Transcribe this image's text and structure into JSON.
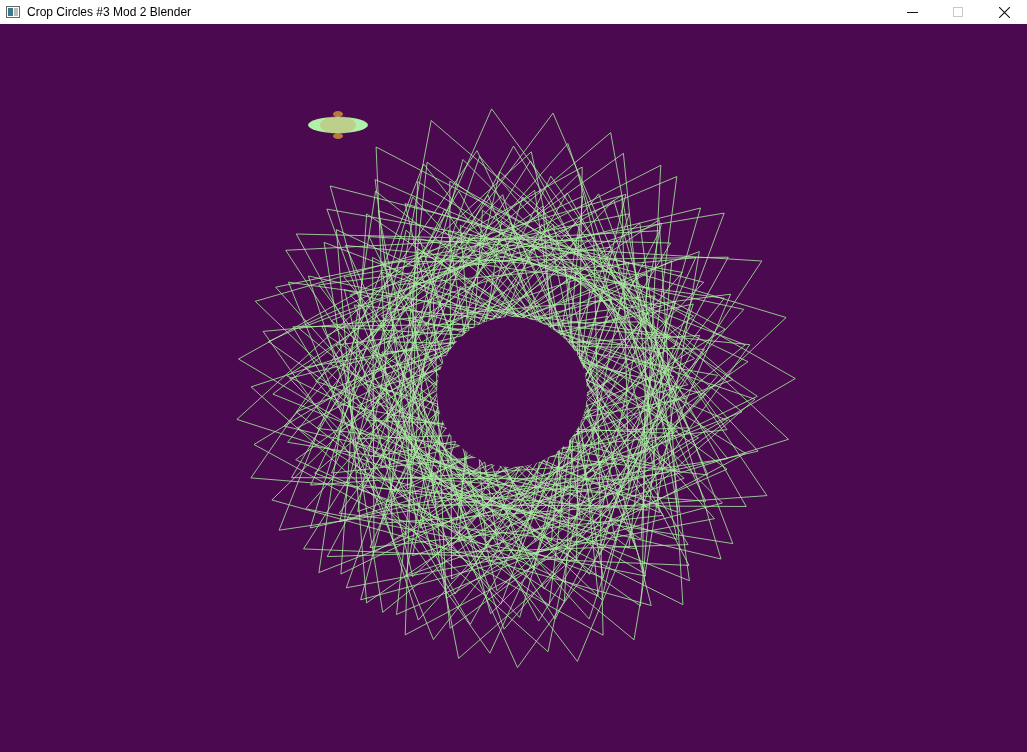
{
  "window": {
    "title": "Crop Circles #3 Mod 2 Blender",
    "controls": [
      {
        "kind": "minimize",
        "disabled": false
      },
      {
        "kind": "maximize",
        "disabled": true
      },
      {
        "kind": "close",
        "disabled": false
      }
    ]
  }
}
